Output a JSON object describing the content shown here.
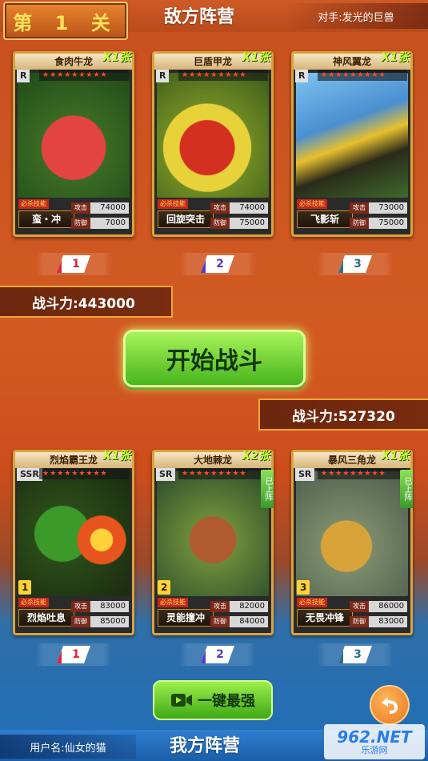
{
  "header": {
    "level_label": "第 1 关",
    "enemy_title": "敌方阵营",
    "opponent_label": "对手:发光的巨兽"
  },
  "enemy": {
    "cards": [
      {
        "name": "食肉牛龙",
        "count": "X1张",
        "rarity": "R",
        "skill": "蛮・冲",
        "attack": "74000",
        "defense": "7000",
        "art_color": "#d43a3a"
      },
      {
        "name": "巨盾甲龙",
        "count": "X1张",
        "rarity": "R",
        "skill": "回旋突击",
        "attack": "74000",
        "defense": "75000",
        "art_color": "#e0c23a"
      },
      {
        "name": "神风翼龙",
        "count": "X1张",
        "rarity": "R",
        "skill": "飞影斩",
        "attack": "73000",
        "defense": "75000",
        "art_color": "#e6c02e"
      }
    ],
    "slots": [
      "1",
      "2",
      "3"
    ],
    "power_label": "战斗力:443000"
  },
  "start_button": "开始战斗",
  "ally": {
    "power_label": "战斗力:527320",
    "cards": [
      {
        "name": "烈焰霸王龙",
        "count": "X1张",
        "rarity": "SSR",
        "level": "1",
        "skill": "烈焰吐息",
        "attack": "83000",
        "defense": "85000",
        "side_tag": "",
        "art_color": "#3c8c2a"
      },
      {
        "name": "大地棘龙",
        "count": "X2张",
        "rarity": "SR",
        "level": "2",
        "skill": "灵能撞冲",
        "attack": "82000",
        "defense": "84000",
        "side_tag": "已上阵",
        "art_color": "#a0502a"
      },
      {
        "name": "暴风三角龙",
        "count": "X1张",
        "rarity": "SR",
        "level": "3",
        "skill": "无畏冲锋",
        "attack": "86000",
        "defense": "83000",
        "side_tag": "已上阵",
        "art_color": "#d6a02a"
      }
    ],
    "slots": [
      "1",
      "2",
      "3"
    ]
  },
  "oneclick_button": "一键最强",
  "footer": {
    "username": "用户名:仙女的猫",
    "ally_title": "我方阵营"
  },
  "watermark": {
    "main": "962.NET",
    "sub": "乐游网"
  },
  "card_labels": {
    "skill_tag": "必杀技能",
    "attack": "攻击",
    "defense": "防御"
  }
}
